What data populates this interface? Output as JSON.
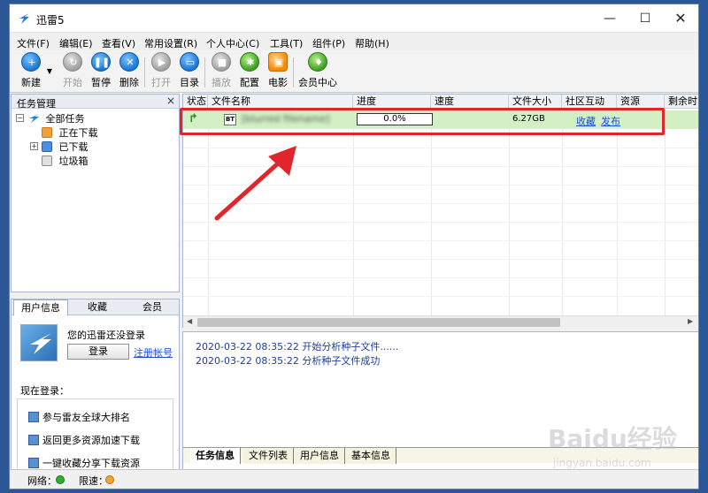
{
  "app": {
    "title": "迅雷5",
    "controls": {
      "minimize": "—",
      "maximize": "☐",
      "close": "✕"
    }
  },
  "menu": [
    "文件(F)",
    "编辑(E)",
    "查看(V)",
    "常用设置(R)",
    "个人中心(C)",
    "工具(T)",
    "组件(P)",
    "帮助(H)"
  ],
  "toolbar": {
    "new": "新建",
    "start": "开始",
    "pause": "暂停",
    "delete": "删除",
    "open": "打开",
    "directory": "目录",
    "play": "播放",
    "config": "配置",
    "movie": "电影",
    "vip_center": "会员中心"
  },
  "task_panel": {
    "title": "任务管理",
    "close": "×",
    "tree": {
      "all": "全部任务",
      "downloading": "正在下载",
      "downloaded": "已下载",
      "trash": "垃圾箱"
    }
  },
  "user_panel": {
    "tabs": [
      "用户信息",
      "收藏",
      "会员"
    ],
    "not_logged_in": "您的迅雷还没登录",
    "login_button": "登录",
    "register_link": "注册帐号",
    "now_login": "现在登录：",
    "promos": [
      "参与雷友全球大排名",
      "返回更多资源加速下载",
      "一键收藏分享下载资源"
    ]
  },
  "task_list": {
    "columns": [
      "状态",
      "文件名称",
      "进度",
      "速度",
      "文件大小",
      "社区互动",
      "资源",
      "剩余时"
    ],
    "tasks": [
      {
        "name": "[blurred filename]",
        "progress_text": "0.0%",
        "progress": 0.0,
        "size": "6.27GB",
        "actions": [
          "收藏",
          "发布"
        ]
      }
    ]
  },
  "log": {
    "lines": [
      "2020-03-22 08:35:22 开始分析种子文件......",
      "2020-03-22 08:35:22 分析种子文件成功"
    ],
    "tabs": [
      "任务信息",
      "文件列表",
      "用户信息",
      "基本信息"
    ]
  },
  "statusbar": {
    "network_label": "网络：",
    "speed_limit_label": "限速："
  },
  "watermark": {
    "logo": "Baidu经验",
    "url": "jingyan.baidu.com"
  },
  "colors": {
    "highlight": "#e0262b",
    "task_row_bg": "#d2f0c3",
    "link": "#1a4fd1",
    "log_text": "#1b3d9b"
  }
}
